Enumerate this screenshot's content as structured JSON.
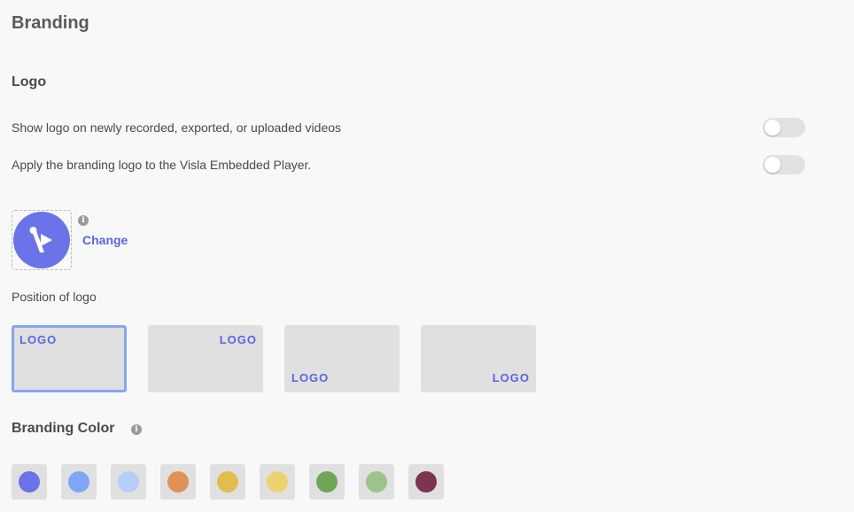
{
  "page": {
    "title": "Branding"
  },
  "logo_section": {
    "title": "Logo",
    "settings": [
      {
        "label": "Show logo on newly recorded, exported, or uploaded videos",
        "enabled": false
      },
      {
        "label": "Apply the branding logo to the Visla Embedded Player.",
        "enabled": false
      }
    ],
    "change_label": "Change",
    "info_icon": "info-icon",
    "logo_color": "#6a73e8"
  },
  "position": {
    "label": "Position of logo",
    "options": [
      {
        "text": "LOGO",
        "placement": "top-left",
        "selected": true
      },
      {
        "text": "LOGO",
        "placement": "top-right",
        "selected": false
      },
      {
        "text": "LOGO",
        "placement": "bottom-left",
        "selected": false
      },
      {
        "text": "LOGO",
        "placement": "bottom-right",
        "selected": false
      }
    ]
  },
  "branding_color": {
    "title": "Branding Color",
    "info_icon": "info-icon",
    "colors": [
      "#6a73e8",
      "#7fa6f6",
      "#b5cdf7",
      "#df9158",
      "#e2bd4e",
      "#ecd26e",
      "#6ea656",
      "#9ac48a",
      "#7b3550"
    ]
  }
}
